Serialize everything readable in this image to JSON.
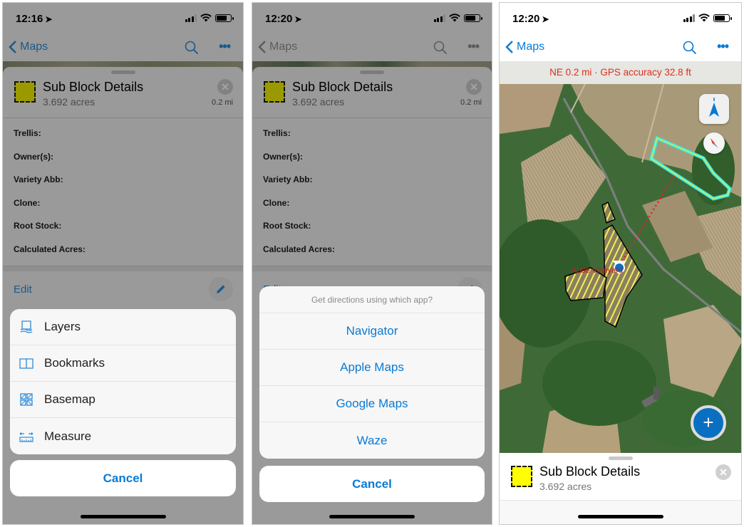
{
  "screens": [
    {
      "status_time": "12:16",
      "nav": {
        "back_label": "Maps"
      },
      "sheet": {
        "title": "Sub Block Details",
        "subtitle": "3.692 acres",
        "distance": "0.2 mi",
        "fields": [
          "Trellis:",
          "Owner(s):",
          "Variety Abb:",
          "Clone:",
          "Root Stock:",
          "Calculated Acres:"
        ],
        "edit_label": "Edit"
      },
      "action_sheet": {
        "items": [
          {
            "label": "Layers",
            "icon": "layers-icon"
          },
          {
            "label": "Bookmarks",
            "icon": "bookmarks-icon"
          },
          {
            "label": "Basemap",
            "icon": "basemap-icon"
          },
          {
            "label": "Measure",
            "icon": "measure-icon"
          }
        ],
        "cancel_label": "Cancel"
      }
    },
    {
      "status_time": "12:20",
      "nav": {
        "back_label": "Maps"
      },
      "sheet": {
        "title": "Sub Block Details",
        "subtitle": "3.692 acres",
        "distance": "0.2 mi",
        "fields": [
          "Trellis:",
          "Owner(s):",
          "Variety Abb:",
          "Clone:",
          "Root Stock:",
          "Calculated Acres:"
        ],
        "edit_label": "Edit"
      },
      "action_sheet": {
        "title": "Get directions using which app?",
        "items": [
          "Navigator",
          "Apple Maps",
          "Google Maps",
          "Waze"
        ],
        "cancel_label": "Cancel"
      }
    },
    {
      "status_time": "12:20",
      "nav": {
        "back_label": "Maps"
      },
      "gps_banner": "NE 0.2 mi · GPS accuracy 32.8 ft",
      "map_label": "Abbe Vineyard",
      "fab_label": "+",
      "sheet": {
        "title": "Sub Block Details",
        "subtitle": "3.692 acres"
      }
    }
  ],
  "colors": {
    "accent": "#0a7ad4",
    "gps_text": "#d9301e",
    "selection_outline": "#3ee8e0",
    "swatch_fill": "#ffff00",
    "fab": "#0a6fc0"
  }
}
